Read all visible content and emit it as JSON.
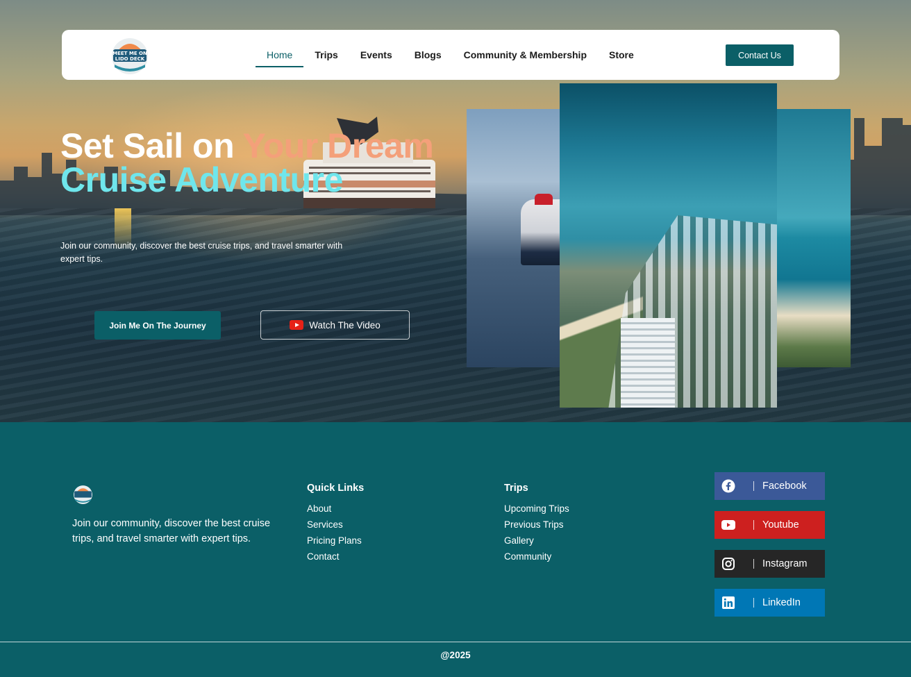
{
  "nav": {
    "logo_text": "MEET ME ON LIDO DECK",
    "items": [
      {
        "label": "Home",
        "active": true
      },
      {
        "label": "Trips"
      },
      {
        "label": "Events"
      },
      {
        "label": "Blogs"
      },
      {
        "label": "Community & Membership"
      },
      {
        "label": "Store"
      }
    ],
    "contact_label": "Contact Us"
  },
  "hero": {
    "title_part1": "Set Sail on ",
    "title_part2": "Your Dream",
    "title_line2": "Cruise Adventure",
    "subtitle": "Join our community, discover the best cruise trips, and travel smarter with expert tips.",
    "primary_button": "Join Me On The Journey",
    "video_button": "Watch The Video"
  },
  "footer": {
    "description": "Join our community, discover the best cruise trips, and travel smarter with expert tips.",
    "quick_links": {
      "heading": "Quick Links",
      "items": [
        "About",
        "Services",
        "Pricing Plans",
        "Contact"
      ]
    },
    "trips": {
      "heading": "Trips",
      "items": [
        "Upcoming Trips",
        "Previous Trips",
        "Gallery",
        "Community"
      ]
    },
    "social": [
      {
        "label": "Facebook",
        "icon": "facebook-icon",
        "color": "#3b5998"
      },
      {
        "label": "Youtube",
        "icon": "youtube-icon",
        "color": "#cd201f"
      },
      {
        "label": "Instagram",
        "icon": "instagram-icon",
        "color": "#262626"
      },
      {
        "label": "LinkedIn",
        "icon": "linkedin-icon",
        "color": "#0077b5"
      }
    ],
    "copyright": "@2025"
  },
  "colors": {
    "brand": "#0b5f67",
    "title_accent_orange": "#f4a07a",
    "title_accent_cyan": "#6fe6ec"
  }
}
